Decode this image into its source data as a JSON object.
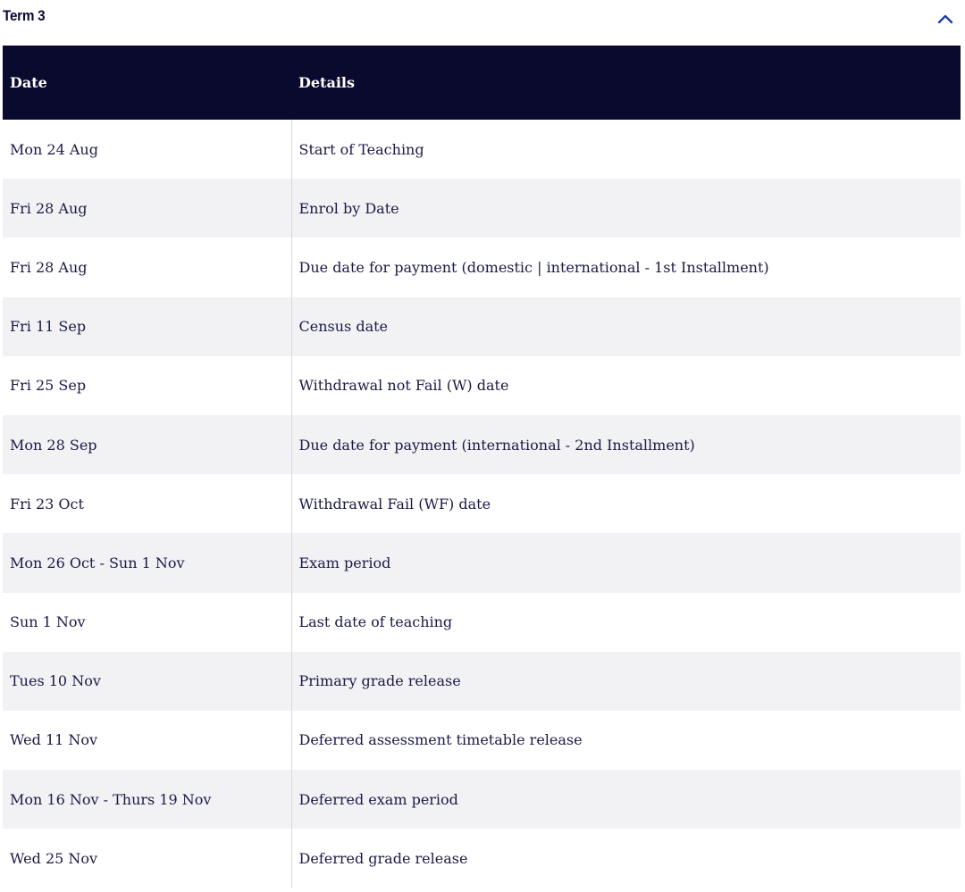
{
  "accordion": {
    "title": "Term 3",
    "toggle_icon": "chevron-up-icon",
    "expanded": true
  },
  "colors": {
    "header_bg": "#0a0a2e",
    "header_text": "#ffffff",
    "text": "#1a1a46",
    "stripe": "#f2f2f5",
    "chevron": "#1f3fae"
  },
  "table": {
    "headers": {
      "date": "Date",
      "details": "Details"
    },
    "rows": [
      {
        "date": "Mon 24 Aug",
        "details": "Start of Teaching"
      },
      {
        "date": "Fri 28 Aug",
        "details": "Enrol by Date"
      },
      {
        "date": "Fri 28 Aug",
        "details": "Due date for payment (domestic | international - 1st Installment)"
      },
      {
        "date": "Fri 11 Sep",
        "details": "Census date"
      },
      {
        "date": "Fri 25 Sep",
        "details": "Withdrawal not Fail (W) date"
      },
      {
        "date": "Mon 28 Sep",
        "details": "Due date for payment (international - 2nd Installment)"
      },
      {
        "date": "Fri 23 Oct",
        "details": "Withdrawal Fail (WF) date"
      },
      {
        "date": "Mon 26 Oct - Sun 1 Nov",
        "details": "Exam period"
      },
      {
        "date": "Sun 1 Nov",
        "details": "Last date of teaching"
      },
      {
        "date": "Tues 10 Nov",
        "details": "Primary grade release"
      },
      {
        "date": "Wed 11 Nov",
        "details": "Deferred assessment timetable release"
      },
      {
        "date": "Mon 16 Nov - Thurs 19 Nov",
        "details": "Deferred exam period"
      },
      {
        "date": "Wed 25 Nov",
        "details": "Deferred grade release"
      }
    ]
  }
}
